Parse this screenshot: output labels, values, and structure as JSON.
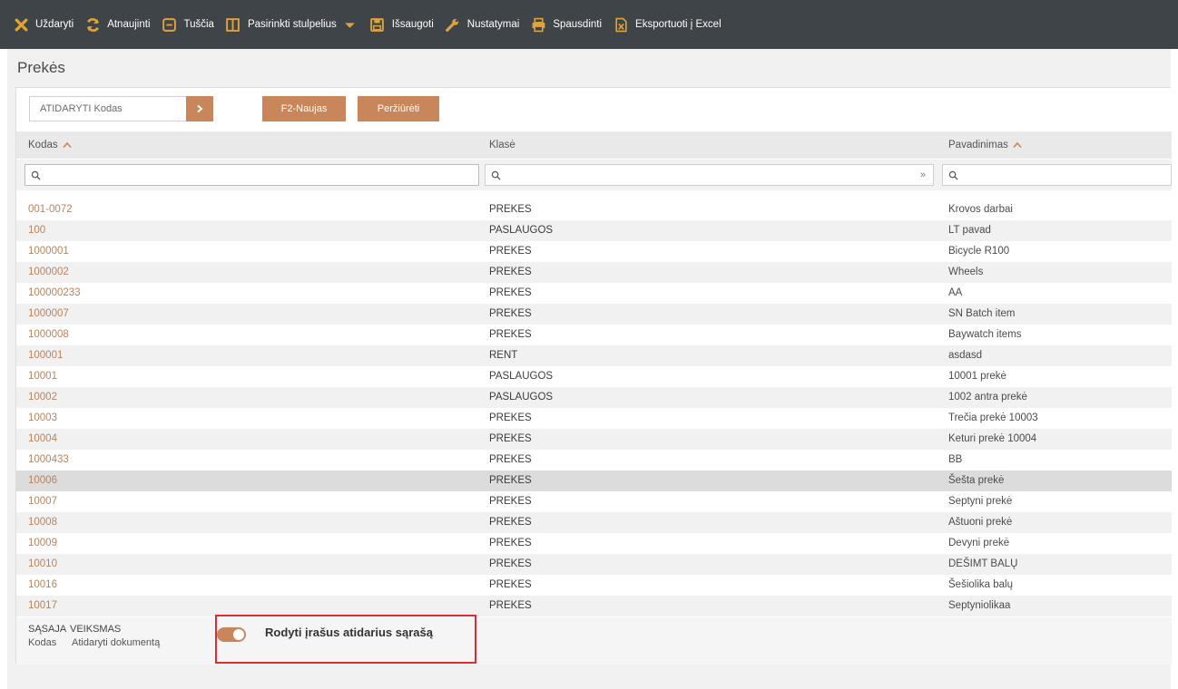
{
  "toolbar": {
    "items": [
      {
        "label": "Uždaryti",
        "icon": "close-icon"
      },
      {
        "label": "Atnaujinti",
        "icon": "refresh-icon"
      },
      {
        "label": "Tuščia",
        "icon": "empty-icon"
      },
      {
        "label": "Pasirinkti stulpelius",
        "icon": "columns-icon"
      },
      {
        "label": "Išsaugoti",
        "icon": "save-icon"
      },
      {
        "label": "Nustatymai",
        "icon": "wrench-icon"
      },
      {
        "label": "Spausdinti",
        "icon": "print-icon"
      },
      {
        "label": "Eksportuoti į Excel",
        "icon": "excel-icon"
      }
    ],
    "dropdown_icon": "caret-down-icon"
  },
  "page": {
    "title": "Prekės"
  },
  "search": {
    "placeholder": "ATIDARYTI Kodas",
    "go_icon": "chevron-right-icon"
  },
  "buttons": {
    "new_label": "F2-Naujas",
    "view_label": "Peržiūrėti"
  },
  "columns": [
    {
      "label": "Kodas",
      "sortable": true
    },
    {
      "label": "Klasė",
      "sortable": false
    },
    {
      "label": "Pavadinimas",
      "sortable": true
    }
  ],
  "filter": {
    "expand_symbol": "»"
  },
  "rows": [
    {
      "code": "001-0072",
      "cls": "PREKES",
      "name": "Krovos darbai"
    },
    {
      "code": "100",
      "cls": "PASLAUGOS",
      "name": "LT pavad"
    },
    {
      "code": "1000001",
      "cls": "PREKES",
      "name": "Bicycle R100"
    },
    {
      "code": "1000002",
      "cls": "PREKES",
      "name": "Wheels"
    },
    {
      "code": "100000233",
      "cls": "PREKES",
      "name": "AA"
    },
    {
      "code": "1000007",
      "cls": "PREKES",
      "name": "SN Batch item"
    },
    {
      "code": "1000008",
      "cls": "PREKES",
      "name": "Baywatch items"
    },
    {
      "code": "100001",
      "cls": "RENT",
      "name": "asdasd"
    },
    {
      "code": "10001",
      "cls": "PASLAUGOS",
      "name": "10001 prekė"
    },
    {
      "code": "10002",
      "cls": "PASLAUGOS",
      "name": "1002 antra prekė"
    },
    {
      "code": "10003",
      "cls": "PREKES",
      "name": "Trečia prekė 10003"
    },
    {
      "code": "10004",
      "cls": "PREKES",
      "name": "Keturi prekė 10004"
    },
    {
      "code": "1000433",
      "cls": "PREKES",
      "name": "BB"
    },
    {
      "code": "10006",
      "cls": "PREKES",
      "name": "Šešta prekė"
    },
    {
      "code": "10007",
      "cls": "PREKES",
      "name": "Septyni prekė"
    },
    {
      "code": "10008",
      "cls": "PREKES",
      "name": "Aštuoni prekė"
    },
    {
      "code": "10009",
      "cls": "PREKES",
      "name": "Devyni prekė"
    },
    {
      "code": "10010",
      "cls": "PREKES",
      "name": "DEŠIMT BALŲ"
    },
    {
      "code": "10016",
      "cls": "PREKES",
      "name": "Šešiolika balų"
    },
    {
      "code": "10017",
      "cls": "PREKES",
      "name": "Septyniolikaa"
    }
  ],
  "selected_row_code": "10006",
  "footer": {
    "sasaja": "SĄSAJA",
    "veiksmas": "VEIKSMAS",
    "kodas": "Kodas",
    "atidaryti": "Atidaryti dokumentą",
    "toggle_label": "Rodyti įrašus atidarius sąrašą",
    "toggle_on": true
  },
  "colors": {
    "accent": "#c8865a",
    "toolbar_bg": "#3f4449",
    "link": "#b7835e",
    "highlight": "#e32a33"
  }
}
